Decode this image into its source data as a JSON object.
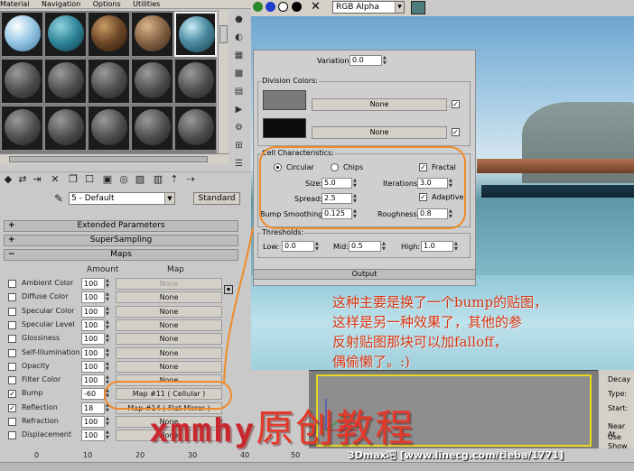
{
  "menu": [
    "Material",
    "Navigation",
    "Options",
    "Utilities"
  ],
  "material": {
    "name": "5 - Default",
    "type_button": "Standard"
  },
  "rollouts": {
    "extended": "Extended Parameters",
    "supersampling": "SuperSampling",
    "maps": "Maps"
  },
  "maps": {
    "col_amount": "Amount",
    "col_map": "Map",
    "rows": [
      {
        "label": "Ambient Color",
        "checked": false,
        "amount": "100",
        "map": "None",
        "active": false
      },
      {
        "label": "Diffuse Color",
        "checked": false,
        "amount": "100",
        "map": "None",
        "active": true
      },
      {
        "label": "Specular Color",
        "checked": false,
        "amount": "100",
        "map": "None",
        "active": true
      },
      {
        "label": "Specular Level",
        "checked": false,
        "amount": "100",
        "map": "None",
        "active": true
      },
      {
        "label": "Glossiness",
        "checked": false,
        "amount": "100",
        "map": "None",
        "active": true
      },
      {
        "label": "Self-Illumination",
        "checked": false,
        "amount": "100",
        "map": "None",
        "active": true
      },
      {
        "label": "Opacity",
        "checked": false,
        "amount": "100",
        "map": "None",
        "active": true
      },
      {
        "label": "Filter Color",
        "checked": false,
        "amount": "100",
        "map": "None",
        "active": true
      },
      {
        "label": "Bump",
        "checked": true,
        "amount": "-60",
        "map": "Map #11  ( Cellular )",
        "active": true
      },
      {
        "label": "Reflection",
        "checked": true,
        "amount": "18",
        "map": "Map #14  ( Flat Mirror )",
        "active": true
      },
      {
        "label": "Refraction",
        "checked": false,
        "amount": "100",
        "map": "None",
        "active": true
      },
      {
        "label": "Displacement",
        "checked": false,
        "amount": "100",
        "map": "None",
        "active": true
      }
    ]
  },
  "viewer": {
    "channel": "RGB Alpha",
    "swatch": "#4c7c7c"
  },
  "cellular": {
    "variation_label": "Variation:",
    "variation": "0.0",
    "division_title": "Division Colors:",
    "color1": "#7a7a7a",
    "color2": "#0c0c0c",
    "none1": "None",
    "none2": "None",
    "cell_title": "Cell Characteristics:",
    "circular": "Circular",
    "chips": "Chips",
    "fractal": "Fractal",
    "size_label": "Size:",
    "size": "5.0",
    "spread_label": "Spread:",
    "spread": "2.5",
    "bump_label": "Bump Smoothing:",
    "bump": "0.125",
    "iter_label": "Iterations:",
    "iter": "3.0",
    "adaptive": "Adaptive",
    "rough_label": "Roughness:",
    "rough": "0.8",
    "thresh_title": "Thresholds:",
    "low_label": "Low:",
    "low": "0.0",
    "mid_label": "Mid:",
    "mid": "0.5",
    "high_label": "High:",
    "high": "1.0",
    "output": "Output"
  },
  "annotation": {
    "line1": "这种主要是换了一个bump的贴图，",
    "line2": "这样是另一种效果了，其他的参",
    "line3": "反射贴图那块可以加falloff，",
    "line4": "偶偷懒了。:)"
  },
  "watermark": {
    "latin": "xmmhy",
    "cn": "原创教程",
    "url": "3Dmax吧 [www.linecg.com/tieba/1771]"
  },
  "ruler": [
    "0",
    "10",
    "20",
    "30",
    "40",
    "50"
  ],
  "decay": {
    "title": "Decay",
    "type": "Type:",
    "start": "Start:",
    "near": "Near At",
    "use": "Use",
    "show": "Show"
  }
}
